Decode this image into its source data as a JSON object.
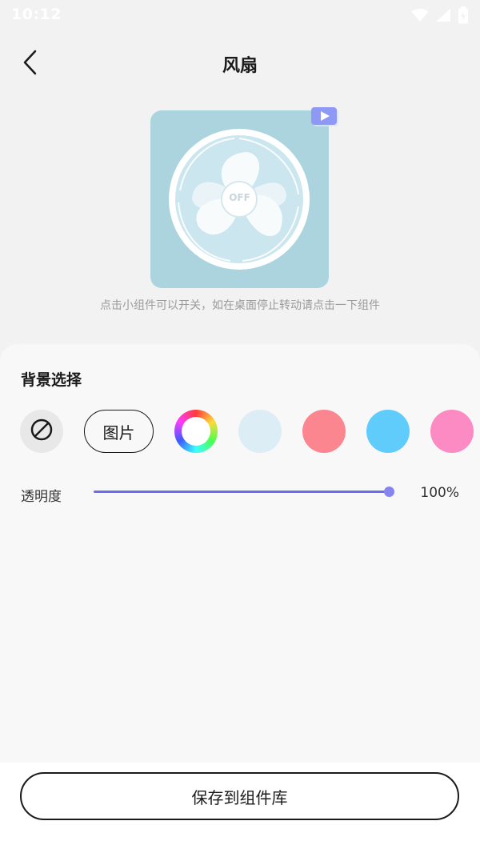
{
  "status_bar": {
    "time": "10:12",
    "icons": [
      "wifi-icon",
      "signal-icon",
      "battery-icon"
    ]
  },
  "header": {
    "back_icon": "chevron-left-icon",
    "title": "风扇"
  },
  "preview": {
    "fan_state_label": "OFF",
    "background_color": "#abd4df",
    "badge_icon": "video-play-icon"
  },
  "hint": "点击小组件可以开关，如在桌面停止转动请点击一下组件",
  "background_select": {
    "title": "背景选择",
    "none_icon": "no-background-icon",
    "image_label": "图片",
    "color_wheel_icon": "color-wheel-icon",
    "color_swatches": [
      "#dcedf5",
      "#fb8690",
      "#60ccfb",
      "#fc8ac3"
    ]
  },
  "opacity": {
    "label": "透明度",
    "value_text": "100%",
    "level": 1.0,
    "accent_color": "#6c6cf0"
  },
  "save_button": {
    "label": "保存到组件库"
  }
}
